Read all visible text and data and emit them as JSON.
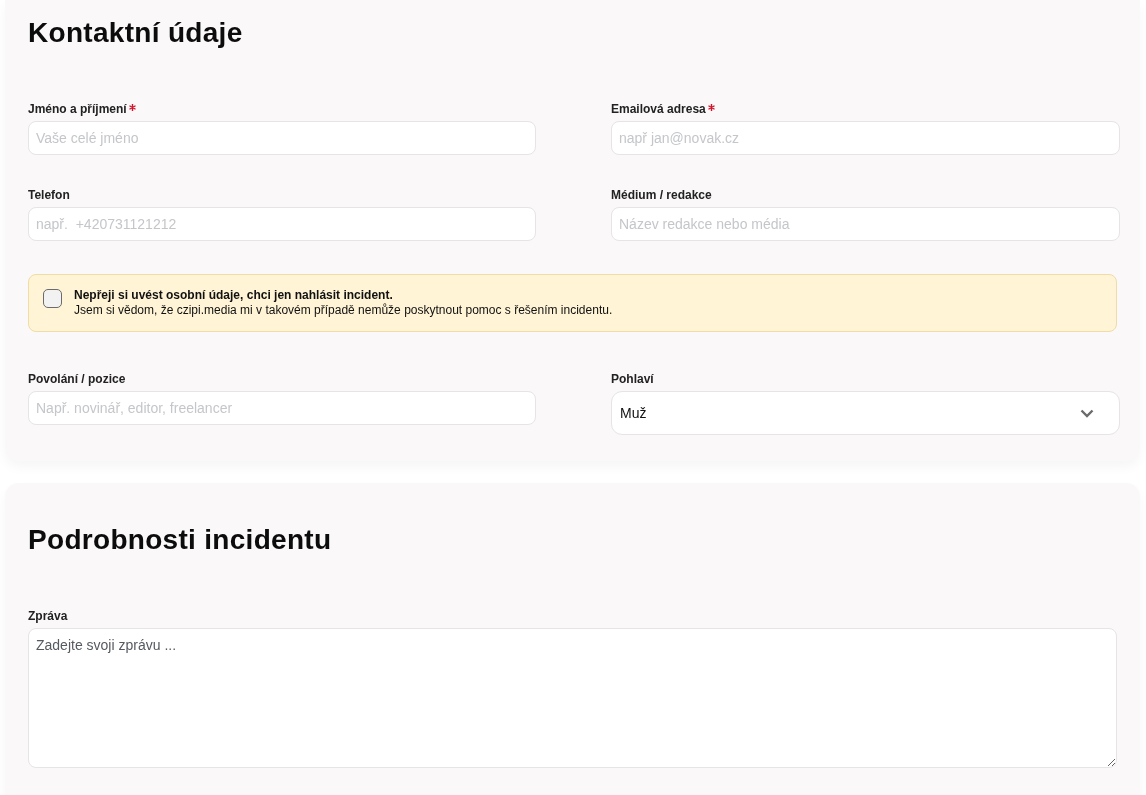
{
  "sections": [
    {
      "title": "Kontaktní údaje",
      "rows": [
        {
          "kind": "fields",
          "fields": [
            {
              "label": "Jméno a příjmení",
              "required": true,
              "placeholder": "Vaše celé jméno"
            },
            {
              "label": "Emailová adresa",
              "required": true,
              "placeholder": "např jan@novak.cz"
            }
          ]
        },
        {
          "kind": "fields",
          "fields": [
            {
              "label": "Telefon",
              "required": false,
              "placeholder": "např.  +420731121212"
            },
            {
              "label": "Médium / redakce",
              "required": false,
              "placeholder": "Název redakce nebo média"
            }
          ]
        },
        {
          "kind": "notice",
          "checked": false,
          "title": "Nepřeji si uvést osobní údaje, chci jen nahlásit incident.",
          "text": "Jsem si vědom, že czipi.media mi v takovém případě nemůže poskytnout pomoc s řešením incidentu."
        },
        {
          "kind": "fields",
          "fields": [
            {
              "label": "Povolání / pozice",
              "required": false,
              "placeholder": "Např. novinář, editor, freelancer"
            },
            {
              "label": "Pohlaví",
              "required": false,
              "kind": "select",
              "value": "Muž"
            }
          ]
        }
      ]
    },
    {
      "title": "Podrobnosti incidentu",
      "rows": [
        {
          "kind": "textarea",
          "label": "Zpráva",
          "required": false,
          "placeholder": "Zadejte svoji zprávu ..."
        }
      ]
    }
  ]
}
